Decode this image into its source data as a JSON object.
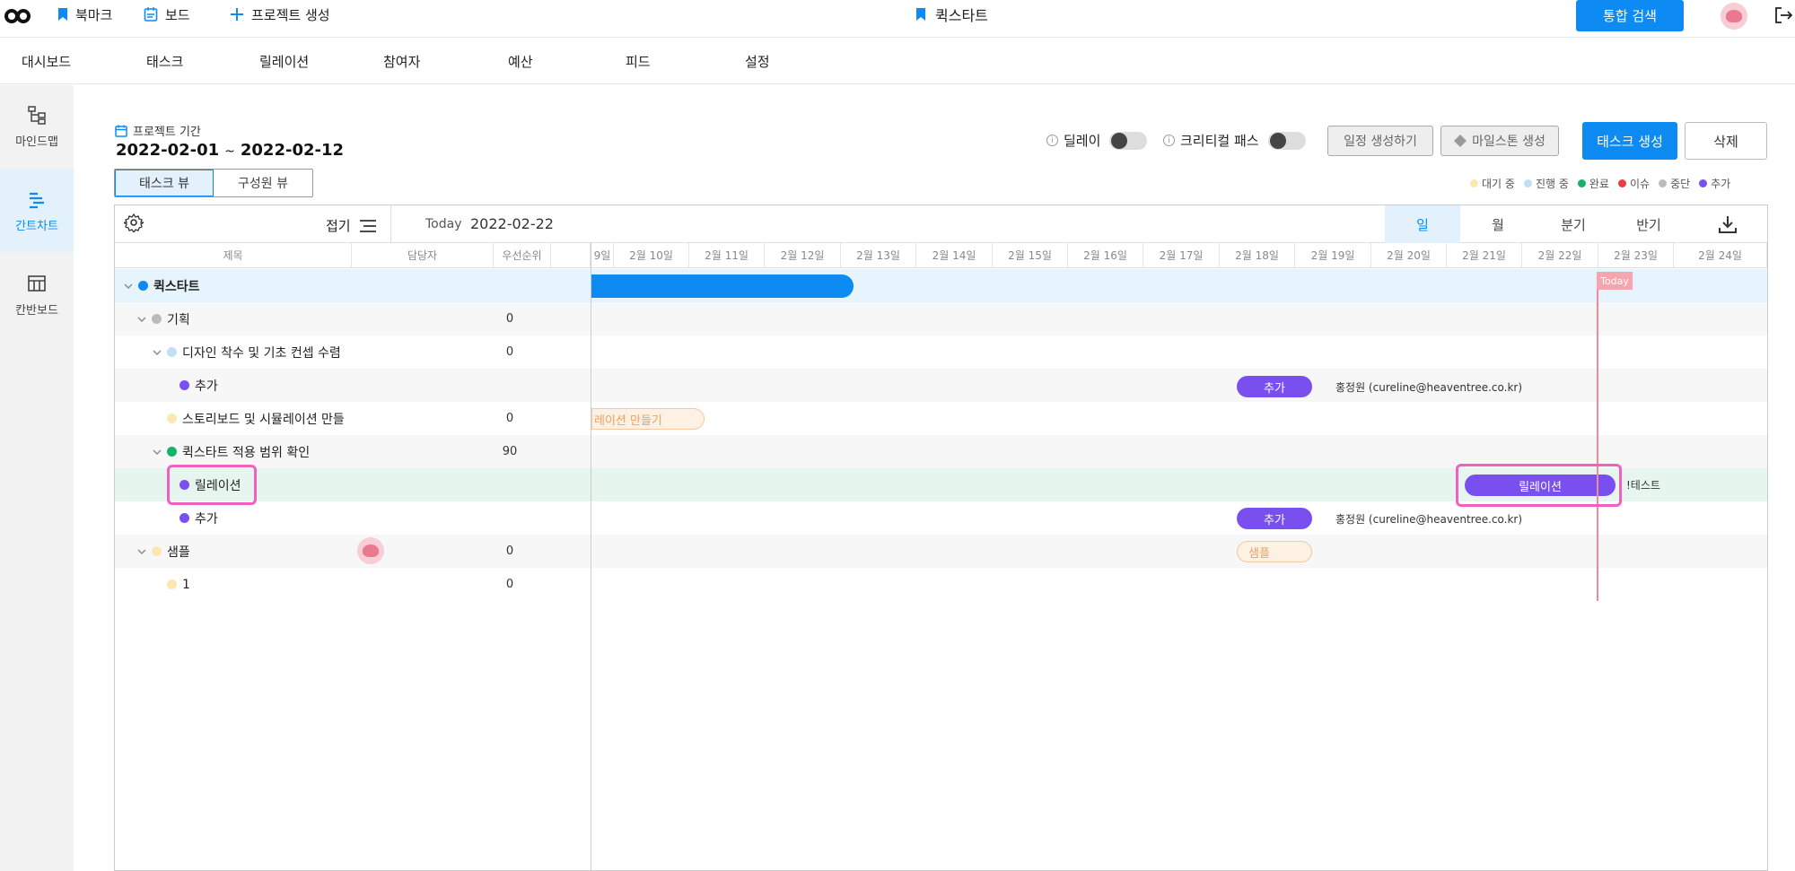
{
  "topbar": {
    "bookmark": "북마크",
    "board": "보드",
    "create_project": "프로젝트 생성",
    "current_project": "퀵스타트",
    "search": "통합 검색"
  },
  "nav": [
    "대시보드",
    "태스크",
    "릴레이션",
    "참여자",
    "예산",
    "피드",
    "설정"
  ],
  "sidebar": [
    {
      "label": "마인드맵",
      "icon": "mindmap-icon"
    },
    {
      "label": "간트차트",
      "icon": "gantt-icon"
    },
    {
      "label": "칸반보드",
      "icon": "kanban-icon"
    }
  ],
  "project": {
    "period_label": "프로젝트 기간",
    "start": "2022-02-01",
    "tilde": "~",
    "end": "2022-02-12"
  },
  "views": {
    "task": "태스크 뷰",
    "member": "구성원 뷰"
  },
  "toggles": {
    "delay": "딜레이",
    "critical": "크리티컬 패스"
  },
  "buttons": {
    "make_schedule": "일정 생성하기",
    "milestone": "마일스톤 생성",
    "create_task": "태스크 생성",
    "delete": "삭제"
  },
  "legend": [
    {
      "label": "대기 중",
      "color": "#fde7b0"
    },
    {
      "label": "진행 중",
      "color": "#bfe0f7"
    },
    {
      "label": "완료",
      "color": "#17b26a"
    },
    {
      "label": "이슈",
      "color": "#f03c3c"
    },
    {
      "label": "중단",
      "color": "#bbbbbb"
    },
    {
      "label": "추가",
      "color": "#7a4ff0"
    }
  ],
  "gantt": {
    "fold": "접기",
    "today_label": "Today",
    "today_date": "2022-02-22",
    "scales": [
      "일",
      "월",
      "분기",
      "반기"
    ],
    "columns": {
      "title": "제목",
      "assignee": "담당자",
      "priority": "우선순위"
    },
    "dates": [
      "9일",
      "2월 10일",
      "2월 11일",
      "2월 12일",
      "2월 13일",
      "2월 14일",
      "2월 15일",
      "2월 16일",
      "2월 17일",
      "2월 18일",
      "2월 19일",
      "2월 20일",
      "2월 21일",
      "2월 22일",
      "2월 23일",
      "2월 24일"
    ],
    "today_tag": "Today"
  },
  "rows": [
    {
      "name": "퀵스타트",
      "priority": "",
      "color": "#0d8bf2"
    },
    {
      "name": "기획",
      "priority": "0",
      "color": "#bbbbbb"
    },
    {
      "name": "디자인 착수 및 기초 컨셉 수렴",
      "priority": "0",
      "color": "#bfe0f7"
    },
    {
      "name": "추가",
      "priority": "",
      "color": "#7a4ff0"
    },
    {
      "name": "스토리보드 및 시뮬레이션 만들",
      "priority": "0",
      "color": "#fde7b0"
    },
    {
      "name": "퀵스타트 적용 범위 확인",
      "priority": "90",
      "color": "#17b26a"
    },
    {
      "name": "릴레이션",
      "priority": "",
      "color": "#7a4ff0"
    },
    {
      "name": "추가",
      "priority": "",
      "color": "#7a4ff0"
    },
    {
      "name": "샘플",
      "priority": "0",
      "color": "#fde7b0"
    },
    {
      "name": "1",
      "priority": "0",
      "color": "#fde7b0"
    }
  ],
  "bars": {
    "add_1": "추가",
    "add_1_assignee": "홍정원 (cureline@heaventree.co.kr)",
    "storyboard": "레이션 만들기",
    "relation": "릴레이션",
    "relation_label": "!테스트",
    "add_2": "추가",
    "add_2_assignee": "홍정원 (cureline@heaventree.co.kr)",
    "sample": "샘플"
  }
}
